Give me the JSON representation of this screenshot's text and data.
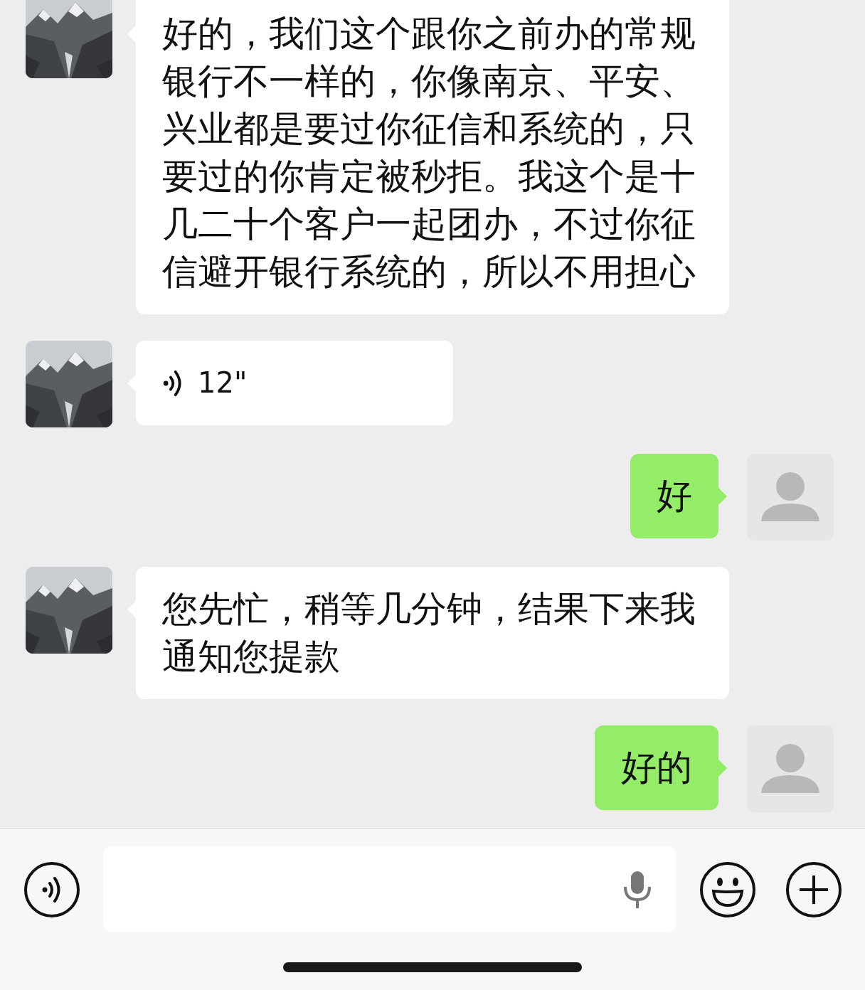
{
  "messages": [
    {
      "outgoing": false,
      "kind": "text",
      "text": "好的，我们这个跟你之前办的常规银行不一样的，你像南京、平安、兴业都是要过你征信和系统的，只要过的你肯定被秒拒。我这个是十几二十个客户一起团办，不过你征信避开银行系统的，所以不用担心"
    },
    {
      "outgoing": false,
      "kind": "voice",
      "duration": "12\""
    },
    {
      "outgoing": true,
      "kind": "text",
      "text": "好"
    },
    {
      "outgoing": false,
      "kind": "text",
      "text": "您先忙，稍等几分钟，结果下来我通知您提款"
    },
    {
      "outgoing": true,
      "kind": "text",
      "text": "好的"
    }
  ]
}
